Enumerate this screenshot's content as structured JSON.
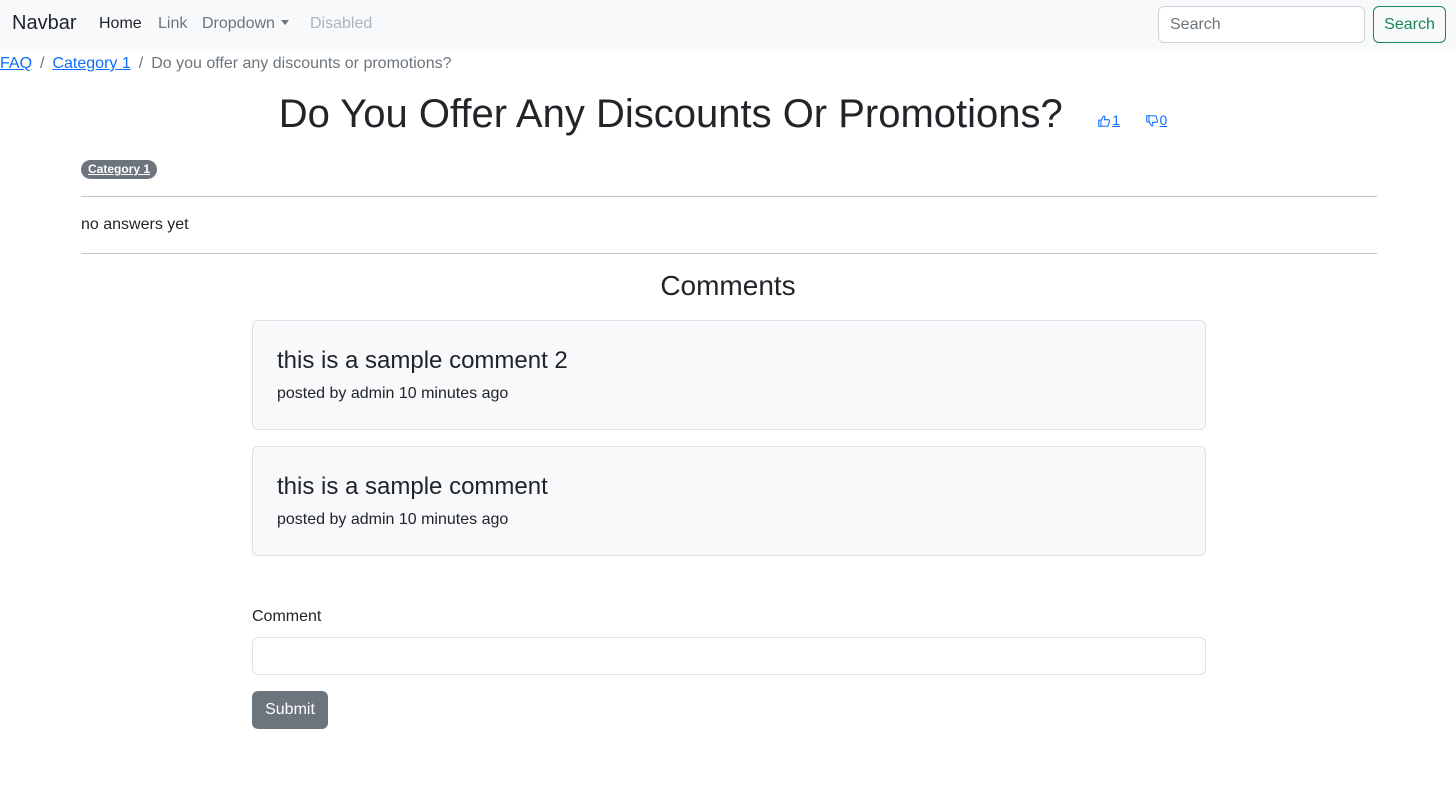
{
  "navbar": {
    "brand": "Navbar",
    "links": [
      {
        "label": "Home",
        "state": "active"
      },
      {
        "label": "Link",
        "state": "normal"
      },
      {
        "label": "Dropdown",
        "state": "dropdown"
      },
      {
        "label": "Disabled",
        "state": "disabled"
      }
    ],
    "search_placeholder": "Search",
    "search_button": "Search"
  },
  "breadcrumb": {
    "items": [
      "FAQ",
      "Category 1"
    ],
    "separator": "/",
    "current": "Do you offer any discounts or promotions?"
  },
  "question": {
    "title": "Do You Offer Any Discounts Or Promotions?",
    "upvotes": "1",
    "downvotes": "0",
    "category_badge": "Category 1"
  },
  "answers": {
    "empty_text": "no answers yet"
  },
  "comments": {
    "heading": "Comments",
    "items": [
      {
        "text": "this is a sample comment 2",
        "meta": "posted by admin 10 minutes ago"
      },
      {
        "text": "this is a sample comment",
        "meta": "posted by admin 10 minutes ago"
      }
    ]
  },
  "comment_form": {
    "label": "Comment",
    "value": "",
    "submit_label": "Submit"
  },
  "colors": {
    "primary": "#0d6efd",
    "success": "#198754",
    "secondary": "#6c757d",
    "navbar_bg": "#f8f9fa"
  },
  "icons": {
    "upvote": "thumbs-up-icon",
    "downvote": "thumbs-down-icon",
    "dropdown": "caret-down-icon"
  }
}
